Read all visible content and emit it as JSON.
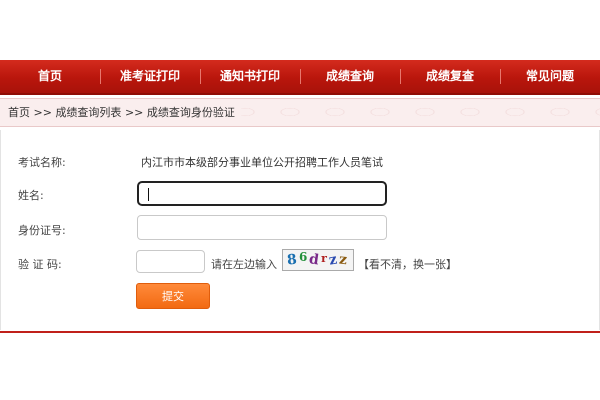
{
  "nav": {
    "items": [
      {
        "label": "首页"
      },
      {
        "label": "准考证打印"
      },
      {
        "label": "通知书打印"
      },
      {
        "label": "成绩查询"
      },
      {
        "label": "成绩复查"
      },
      {
        "label": "常见问题"
      }
    ]
  },
  "breadcrumb": {
    "home": "首页",
    "separator": ">>",
    "list": "成绩查询列表",
    "current": "成绩查询身份验证"
  },
  "form": {
    "exam_label": "考试名称:",
    "exam_value": "内江市市本级部分事业单位公开招聘工作人员笔试",
    "name_label": "姓名:",
    "name_value": "",
    "id_label": "身份证号:",
    "id_value": "",
    "captcha_label": "验 证 码:",
    "captcha_value": "",
    "captcha_hint": "请在左边输入",
    "captcha_chars": [
      "8",
      "6",
      "d",
      "r",
      "z",
      "z"
    ],
    "captcha_refresh": "【看不清，换一张】",
    "submit_label": "提交"
  },
  "colors": {
    "nav_red": "#c41d12",
    "submit_orange": "#f57a22"
  }
}
